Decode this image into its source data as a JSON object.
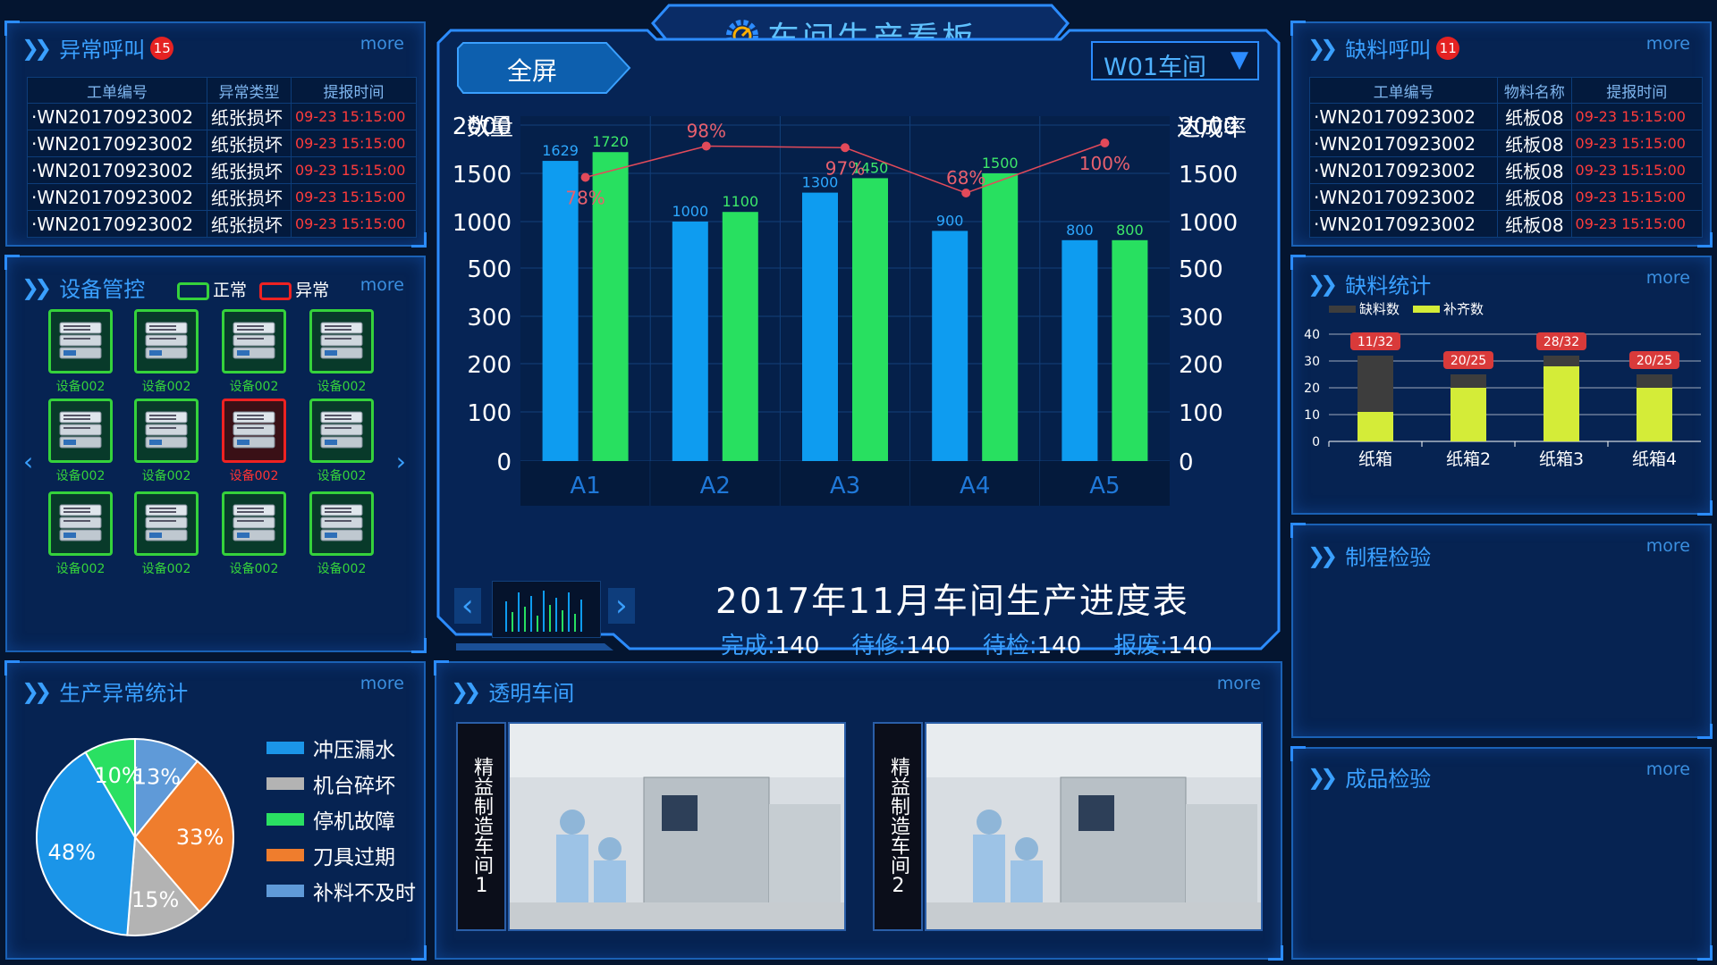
{
  "header": {
    "title": "车间生产看板",
    "fullscreen": "全屏",
    "workshop": "W01车间"
  },
  "alarm": {
    "title": "异常呼叫",
    "count": "15",
    "more": "more",
    "cols": [
      "工单编号",
      "异常类型",
      "提报时间"
    ],
    "rows": [
      [
        "·WN20170923002",
        "纸张损坏",
        "09-23 15:15:00"
      ],
      [
        "·WN20170923002",
        "纸张损坏",
        "09-23 15:15:00"
      ],
      [
        "·WN20170923002",
        "纸张损坏",
        "09-23 15:15:00"
      ],
      [
        "·WN20170923002",
        "纸张损坏",
        "09-23 15:15:00"
      ],
      [
        "·WN20170923002",
        "纸张损坏",
        "09-23 15:15:00"
      ]
    ]
  },
  "devices": {
    "title": "设备管控",
    "normal": "正常",
    "abnormal": "异常",
    "more": "more",
    "items": [
      {
        "label": "设备002",
        "status": "normal"
      },
      {
        "label": "设备002",
        "status": "normal"
      },
      {
        "label": "设备002",
        "status": "normal"
      },
      {
        "label": "设备002",
        "status": "normal"
      },
      {
        "label": "设备002",
        "status": "normal"
      },
      {
        "label": "设备002",
        "status": "normal"
      },
      {
        "label": "设备002",
        "status": "error"
      },
      {
        "label": "设备002",
        "status": "normal"
      },
      {
        "label": "设备002",
        "status": "normal"
      },
      {
        "label": "设备002",
        "status": "normal"
      },
      {
        "label": "设备002",
        "status": "normal"
      },
      {
        "label": "设备002",
        "status": "normal"
      }
    ]
  },
  "exception_stats": {
    "title": "生产异常统计",
    "more": "more",
    "legend": [
      {
        "name": "冲压漏水",
        "color": "#1b95e8"
      },
      {
        "name": "机台碎坏",
        "color": "#b3b3b3"
      },
      {
        "name": "停机故障",
        "color": "#2ae062"
      },
      {
        "name": "刀具过期",
        "color": "#ef7d2d"
      },
      {
        "name": "补料不及时",
        "color": "#5f9ad8"
      }
    ]
  },
  "production": {
    "title": "2017年11月车间生产进度表",
    "stats": [
      {
        "label": "完成:",
        "value": "140"
      },
      {
        "label": "待修:",
        "value": "140"
      },
      {
        "label": "待检:",
        "value": "140"
      },
      {
        "label": "报废:",
        "value": "140"
      }
    ]
  },
  "transparent": {
    "title": "透明车间",
    "more": "more",
    "cams": [
      "精益制造车间1",
      "精益制造车间2"
    ]
  },
  "shortage_call": {
    "title": "缺料呼叫",
    "count": "11",
    "more": "more",
    "cols": [
      "工单编号",
      "物料名称",
      "提报时间"
    ],
    "rows": [
      [
        "·WN20170923002",
        "纸板08",
        "09-23 15:15:00"
      ],
      [
        "·WN20170923002",
        "纸板08",
        "09-23 15:15:00"
      ],
      [
        "·WN20170923002",
        "纸板08",
        "09-23 15:15:00"
      ],
      [
        "·WN20170923002",
        "纸板08",
        "09-23 15:15:00"
      ],
      [
        "·WN20170923002",
        "纸板08",
        "09-23 15:15:00"
      ]
    ]
  },
  "shortage_stats": {
    "title": "缺料统计",
    "more": "more"
  },
  "process_check": {
    "title": "制程检验",
    "more": "more"
  },
  "final_check": {
    "title": "成品检验",
    "more": "more"
  },
  "colors": {
    "blue": "#0e9cf0",
    "green": "#28e060",
    "line": "#e24a5a",
    "dark": "#3d3d3d",
    "yellow": "#d4ec38"
  },
  "chart_data": [
    {
      "type": "bar",
      "categories": [
        "A1",
        "A2",
        "A3",
        "A4",
        "A5"
      ],
      "series": [
        {
          "values": [
            1629,
            1000,
            1300,
            900,
            800
          ]
        },
        {
          "values": [
            1720,
            1100,
            1450,
            1500,
            800
          ]
        },
        {
          "type": "line",
          "values": [
            78,
            98,
            97,
            68,
            100
          ]
        }
      ],
      "ylabel": "数量",
      "y2label": "达成率",
      "yticks": [
        "0",
        "100",
        "200",
        "300",
        "500",
        "1000",
        "1500",
        "2000"
      ],
      "y2ticks": [
        "0",
        "100",
        "200",
        "300",
        "500",
        "1000",
        "1500",
        "2000"
      ],
      "value_labels": [
        "1629",
        "1000",
        "1300",
        "900",
        "800",
        "1720",
        "1100",
        "1450",
        "1500",
        "800"
      ],
      "rate_labels": [
        "78%",
        "98%",
        "97%",
        "68%",
        "100%"
      ]
    },
    {
      "type": "bar",
      "categories": [
        "纸箱",
        "纸箱2",
        "纸箱3",
        "纸箱4"
      ],
      "series": [
        {
          "name": "缺料数",
          "values": [
            32,
            25,
            32,
            25
          ]
        },
        {
          "name": "补齐数",
          "values": [
            11,
            20,
            28,
            20
          ]
        }
      ],
      "ylim": [
        0,
        40
      ],
      "yticks": [
        "0",
        "10",
        "20",
        "30",
        "40"
      ],
      "annotations": [
        "11/32",
        "20/25",
        "28/32",
        "20/25"
      ]
    },
    {
      "type": "pie",
      "values": [
        48,
        15,
        33,
        13,
        10
      ],
      "labels": [
        "48%",
        "15%",
        "33%",
        "13%",
        "10%"
      ]
    }
  ]
}
